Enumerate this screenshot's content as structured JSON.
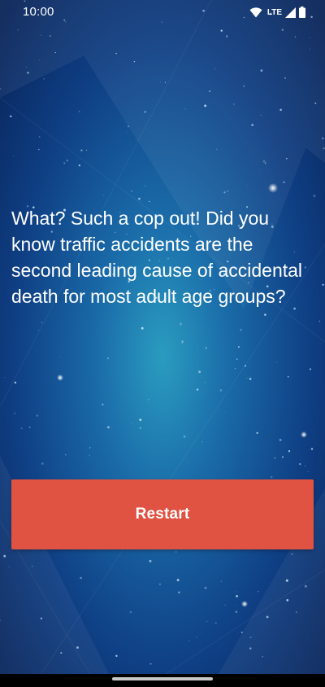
{
  "status_bar": {
    "time": "10:00",
    "network_label": "LTE",
    "icons": [
      "wifi-icon",
      "lte-icon",
      "signal-icon",
      "battery-icon"
    ]
  },
  "main": {
    "message": "What? Such a cop out! Did you know traffic accidents are the second leading cause of accidental death for most adult age groups?",
    "restart_label": "Restart"
  },
  "colors": {
    "background_center": "#1e8fb7",
    "background_edge": "#08245a",
    "button": "#e05241",
    "text": "#ffffff",
    "nav_bar": "#000000"
  }
}
